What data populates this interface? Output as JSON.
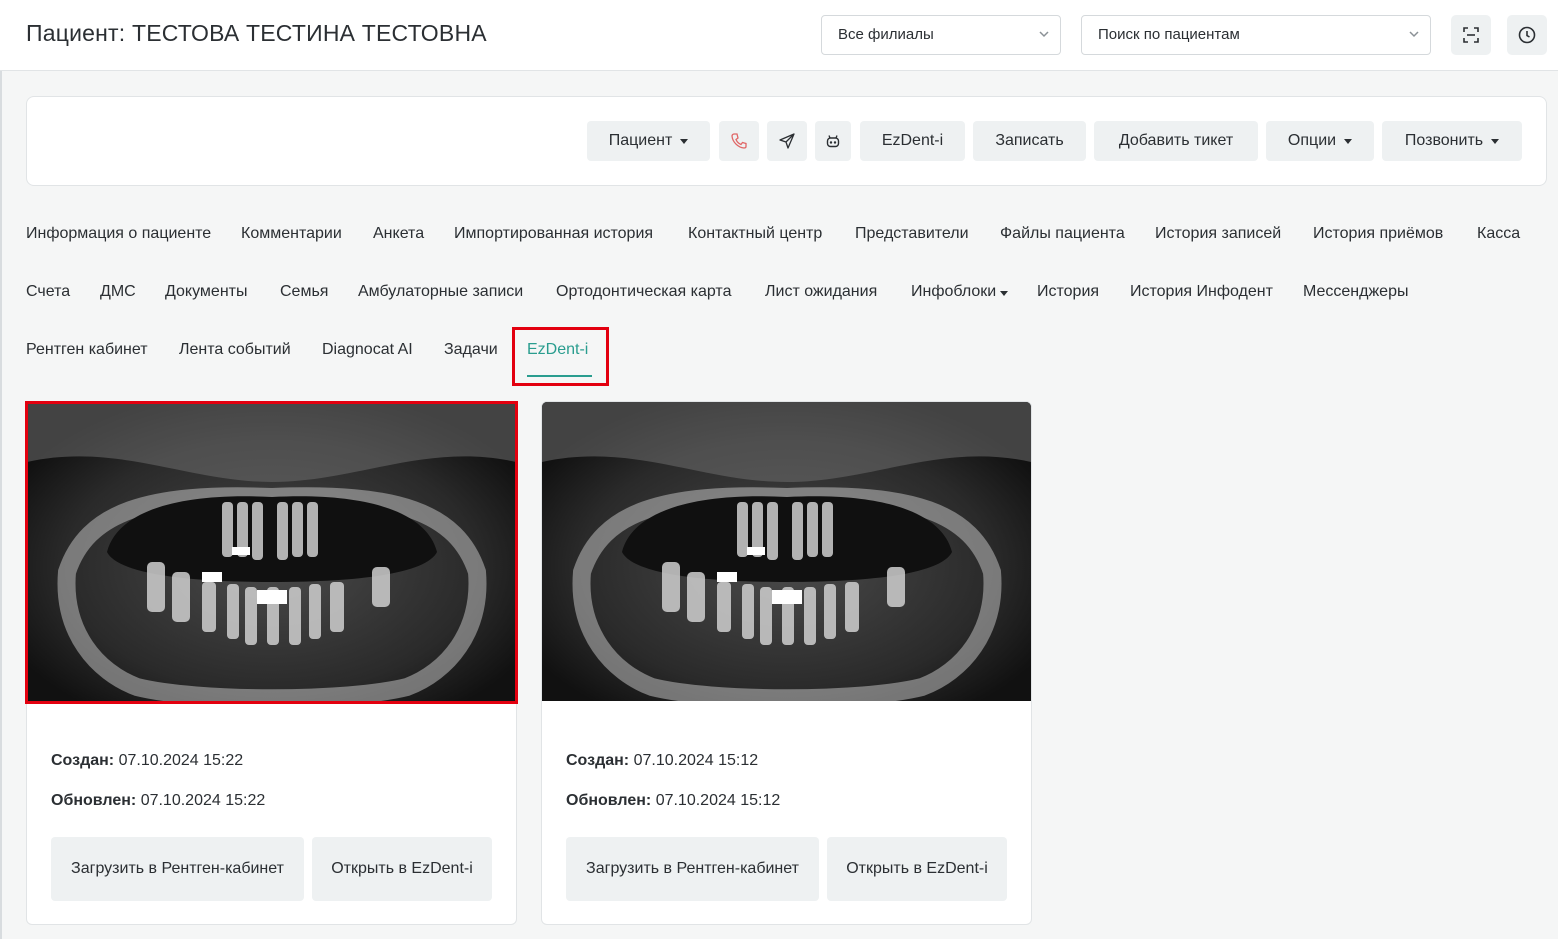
{
  "header": {
    "title": "Пациент: ТЕСТОВА ТЕСТИНА ТЕСТОВНА",
    "branch_select": "Все филиалы",
    "patient_search": "Поиск по пациентам"
  },
  "toolbar": {
    "patient": "Пациент",
    "ezdent": "EzDent-i",
    "book": "Записать",
    "add_ticket": "Добавить тикет",
    "options": "Опции",
    "call": "Позвонить"
  },
  "tabs": {
    "row1": [
      "Информация о пациенте",
      "Комментарии",
      "Анкета",
      "Импортированная история",
      "Контактный центр",
      "Представители",
      "Файлы пациента",
      "История записей",
      "История приёмов",
      "Касса"
    ],
    "row2": [
      "Счета",
      "ДМС",
      "Документы",
      "Семья",
      "Амбулаторные записи",
      "Ортодонтическая карта",
      "Лист ожидания",
      "Инфоблоки",
      "История",
      "История Инфодент",
      "Мессенджеры"
    ],
    "row3": [
      "Рентген кабинет",
      "Лента событий",
      "Diagnocat AI",
      "Задачи",
      "EzDent-i"
    ],
    "active": "EzDent-i"
  },
  "cards": [
    {
      "created_label": "Создан:",
      "created": "07.10.2024 15:22",
      "updated_label": "Обновлен:",
      "updated": "07.10.2024 15:22",
      "upload_button": "Загрузить в Рентген-кабинет",
      "open_button": "Открыть в EzDent-i"
    },
    {
      "created_label": "Создан:",
      "created": "07.10.2024 15:12",
      "updated_label": "Обновлен:",
      "updated": "07.10.2024 15:12",
      "upload_button": "Загрузить в Рентген-кабинет",
      "open_button": "Открыть в EzDent-i"
    }
  ],
  "colors": {
    "accent": "#2a9d8f",
    "highlight": "#e3000f",
    "button_bg": "#eef1f2",
    "phone_icon": "#e06666"
  }
}
